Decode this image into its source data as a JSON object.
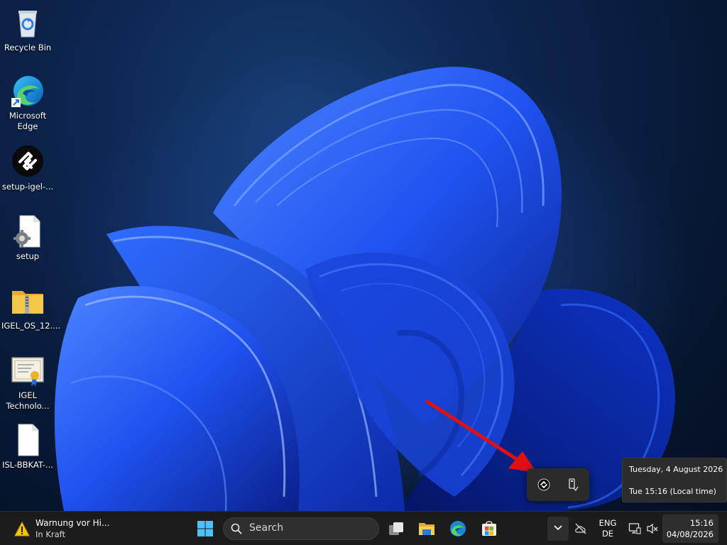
{
  "desktop": {
    "icons": [
      {
        "label": "Recycle Bin",
        "icon": "recycle-bin-icon"
      },
      {
        "label": "Microsoft Edge",
        "icon": "edge-icon"
      },
      {
        "label": "setup-igel-...",
        "icon": "igel-setup-icon"
      },
      {
        "label": "setup",
        "icon": "setup-file-icon"
      },
      {
        "label": "IGEL_OS_12....",
        "icon": "zip-folder-icon"
      },
      {
        "label": "IGEL Technolo...",
        "icon": "certificate-icon"
      },
      {
        "label": "ISL-BBKAT-...",
        "icon": "blank-file-icon"
      }
    ]
  },
  "tooltip": {
    "date_line": "Tuesday, 4 August 2026",
    "time_line": "Tue 15:16 (Local time)"
  },
  "taskbar": {
    "weather": {
      "title": "Warnung vor Hi...",
      "subtitle": "In Kraft",
      "icon": "warning-icon"
    },
    "search_label": "Search",
    "lang_top": "ENG",
    "lang_bottom": "DE",
    "clock_time": "15:16",
    "clock_date": "04/08/2026"
  },
  "colors": {
    "taskbar_bg": "#1c1c1c",
    "accent_blue": "#1f5fff",
    "arrow_red": "#e01010"
  }
}
